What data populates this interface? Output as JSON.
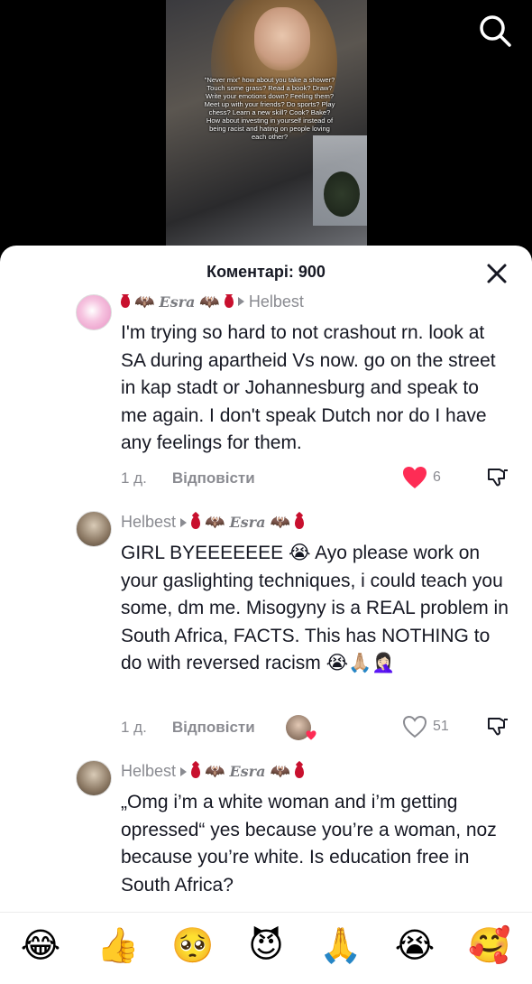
{
  "video": {
    "caption": "\"Never mix\" how about you take a shower? Touch some grass? Read a book? Draw? Write your emotions down? Feeling them? Meet up with your friends? Do sports? Play chess? Learn a new skill? Cook? Bake? How about investing in yourself instead of being racist and hating on people loving each other?"
  },
  "comments_sheet": {
    "title": "Коментарі: 900",
    "comments": [
      {
        "username": "Esra",
        "reply_to": "Helbest",
        "text": "I'm trying so hard to not crashout rn. look at SA during apartheid Vs now. go on the street in kap stadt or Johannesburg and speak to me again. I don't speak Dutch nor do I have any feelings for them.",
        "time": "1 д.",
        "reply_label": "Відповісти",
        "likes": "6",
        "liked": true
      },
      {
        "username": "Helbest",
        "reply_to": "Esra",
        "text": "GIRL BYEEEEEEE 😭 Ayo please work on your gaslighting techniques, i could teach you some, dm me. Misogyny is a REAL problem in South Africa, FACTS. This has NOTHING to do with reversed racism 😭🙏🏼🤦🏻‍♀️",
        "time": "1 д.",
        "reply_label": "Відповісти",
        "likes": "51",
        "liked": false
      },
      {
        "username": "Helbest",
        "reply_to": "Esra",
        "text": "„Omg i’m a white woman and i’m getting opressed“ yes because you’re a woman, noz because you’re white. Is education free in South Africa?"
      }
    ]
  },
  "emoji_bar": [
    "😂",
    "👍",
    "🥺",
    "😈",
    "🙏",
    "😭",
    "🥰"
  ],
  "colors": {
    "like_red": "#fe2c55",
    "muted_text": "#8a8b91",
    "text": "#161823"
  }
}
